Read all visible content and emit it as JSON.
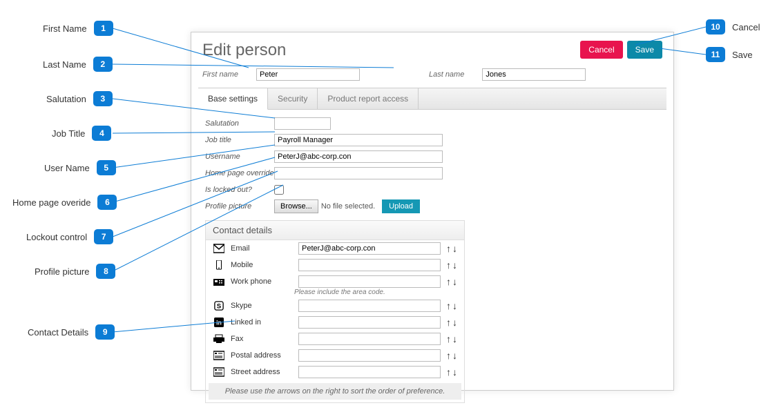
{
  "annotations": [
    {
      "n": "1",
      "label": "First Name"
    },
    {
      "n": "2",
      "label": "Last Name"
    },
    {
      "n": "3",
      "label": "Salutation"
    },
    {
      "n": "4",
      "label": "Job Title"
    },
    {
      "n": "5",
      "label": "User Name"
    },
    {
      "n": "6",
      "label": "Home page overide"
    },
    {
      "n": "7",
      "label": "Lockout control"
    },
    {
      "n": "8",
      "label": "Profile picture"
    },
    {
      "n": "9",
      "label": "Contact Details"
    },
    {
      "n": "10",
      "label": "Cancel"
    },
    {
      "n": "11",
      "label": "Save"
    }
  ],
  "panel": {
    "title": "Edit person",
    "cancel": "Cancel",
    "save": "Save",
    "firstNameLabel": "First name",
    "firstNameValue": "Peter",
    "lastNameLabel": "Last name",
    "lastNameValue": "Jones"
  },
  "tabs": {
    "base": "Base settings",
    "security": "Security",
    "product": "Product report access"
  },
  "fields": {
    "salutation": {
      "label": "Salutation",
      "value": ""
    },
    "jobtitle": {
      "label": "Job title",
      "value": "Payroll Manager"
    },
    "username": {
      "label": "Username",
      "value": "PeterJ@abc-corp.con"
    },
    "homepage": {
      "label": "Home page override",
      "value": ""
    },
    "locked": {
      "label": "Is locked out?"
    },
    "profile": {
      "label": "Profile picture",
      "browse": "Browse...",
      "nofile": "No file selected.",
      "upload": "Upload"
    }
  },
  "contact": {
    "heading": "Contact details",
    "email": {
      "label": "Email",
      "value": "PeterJ@abc-corp.con"
    },
    "mobile": {
      "label": "Mobile",
      "value": ""
    },
    "work": {
      "label": "Work phone",
      "value": "",
      "hint": "Please include the area code."
    },
    "skype": {
      "label": "Skype",
      "value": ""
    },
    "linkedin": {
      "label": "Linked in",
      "value": ""
    },
    "fax": {
      "label": "Fax",
      "value": ""
    },
    "postal": {
      "label": "Postal address",
      "value": ""
    },
    "street": {
      "label": "Street address",
      "value": ""
    },
    "foot": "Please use the arrows on the right to sort the order of preference."
  }
}
